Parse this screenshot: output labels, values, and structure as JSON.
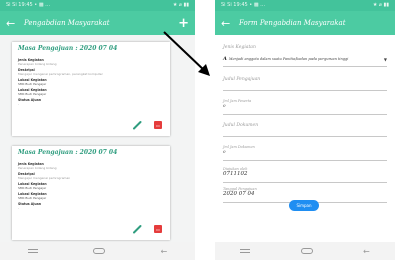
{
  "status_left": "Si Si 19:45 • ▩ …",
  "status_right": "★ ⌀ ▮▮",
  "list_screen": {
    "title": "Pengabdian Masyarakat",
    "back_icon": "←",
    "add_icon": "+",
    "cards": [
      {
        "title": "Masa Pengajuan : 2020 07 04",
        "fields": [
          {
            "label": "Jenis Kegiatan",
            "value": "Penerapan bidang bidang"
          },
          {
            "label": "Deskripsi",
            "value": "Mengajar mengenai pemrograman, perangkat komputer"
          },
          {
            "label": "Lokasi Kegiatan",
            "value": "SMK Budi Pengajar"
          },
          {
            "label": "Lokasi Kegiatan",
            "value": "SMK Budi Pengajar"
          },
          {
            "label": "Status Ajuan",
            "value": "-"
          }
        ]
      },
      {
        "title": "Masa Pengajuan : 2020 07 04",
        "fields": [
          {
            "label": "Jenis Kegiatan",
            "value": "Penerapan bidang bidang"
          },
          {
            "label": "Deskripsi",
            "value": "Mengajar mengenai pemrograman"
          },
          {
            "label": "Lokasi Kegiatan",
            "value": "SMK Budi Pengajar"
          },
          {
            "label": "Lokasi Kegiatan",
            "value": "SMK Budi Pengajar"
          },
          {
            "label": "Status Ajuan",
            "value": "-"
          }
        ]
      }
    ]
  },
  "form_screen": {
    "title": "Form Pengabdian Masyarakat",
    "back_icon": "←",
    "jenis_label": "Jenis Kegiatan",
    "jenis_select": "Menjadi anggota dalam suatu Panitia/badan pada perguruan tinggi",
    "judul_label": "Judul Pengajuan",
    "jml_peserta_label": "Jml Jam Peserta",
    "jml_peserta_value": "0",
    "judul_dokumen_label": "Judul Dokumen",
    "jml_dokumen_label": "Jml Jam Dokumen",
    "jml_dokumen_value": "0",
    "diajukan_label": "Diajukan oleh",
    "diajukan_value": "0711102",
    "tanggal_label": "Tanggal Pengajuan",
    "tanggal_value": "2020 07 04",
    "submit_label": "Simpan"
  },
  "nav": {
    "back": "←"
  },
  "colors": {
    "primary": "#4ccba2",
    "status": "#43c39b",
    "title_text": "#2f9d7f",
    "edit": "#2f9d7f",
    "delete": "#e53c3c",
    "button": "#1f8ef2"
  }
}
